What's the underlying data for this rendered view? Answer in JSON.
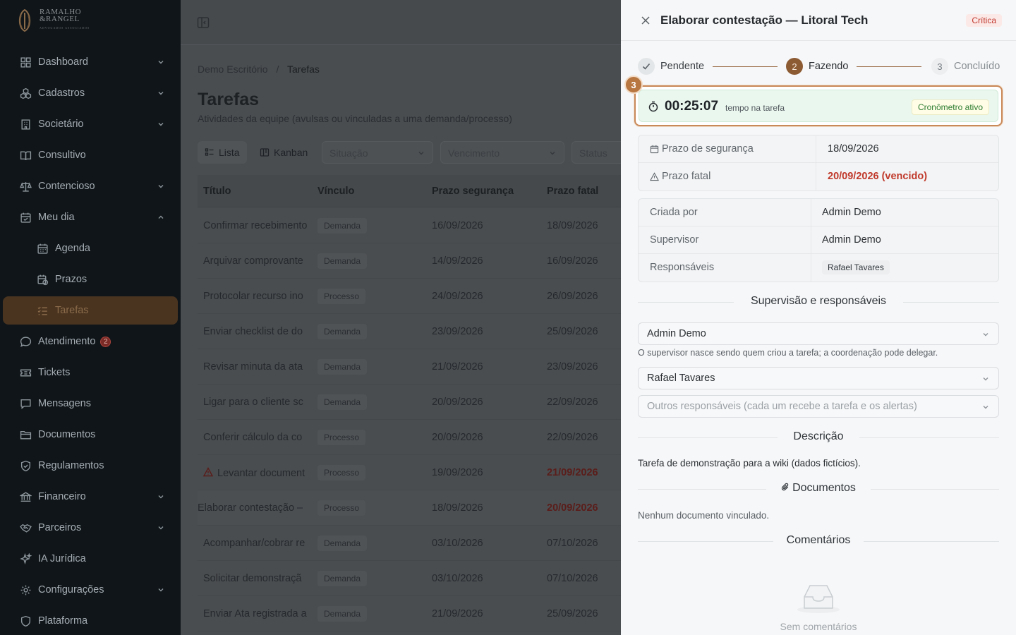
{
  "brand": {
    "name_line1": "RAMALHO",
    "name_line2": "&RANGEL",
    "name_line3": "ADVOGADOS ASSOCIADOS"
  },
  "sidebar": {
    "items": [
      {
        "label": "Dashboard",
        "icon": "dashboard-icon",
        "expandable": true
      },
      {
        "label": "Cadastros",
        "icon": "cubes-icon",
        "expandable": true
      },
      {
        "label": "Societário",
        "icon": "building-icon",
        "expandable": true
      },
      {
        "label": "Consultivo",
        "icon": "book-icon",
        "expandable": false
      },
      {
        "label": "Contencioso",
        "icon": "scale-icon",
        "expandable": true
      },
      {
        "label": "Meu dia",
        "icon": "calendar-icon",
        "expandable": true,
        "expanded": true
      },
      {
        "label": "Agenda",
        "icon": "calendar-grid-icon",
        "sub": true
      },
      {
        "label": "Prazos",
        "icon": "calendar-clock-icon",
        "sub": true
      },
      {
        "label": "Tarefas",
        "icon": "task-list-icon",
        "sub": true,
        "active": true
      },
      {
        "label": "Atendimento",
        "icon": "chat-icon",
        "badge": "2"
      },
      {
        "label": "Tickets",
        "icon": "ticket-icon"
      },
      {
        "label": "Mensagens",
        "icon": "message-icon"
      },
      {
        "label": "Documentos",
        "icon": "folder-icon"
      },
      {
        "label": "Regulamentos",
        "icon": "shield-icon"
      },
      {
        "label": "Financeiro",
        "icon": "bank-icon",
        "expandable": true
      },
      {
        "label": "Parceiros",
        "icon": "handshake-icon",
        "expandable": true
      },
      {
        "label": "IA Jurídica",
        "icon": "sparkles-icon"
      },
      {
        "label": "Configurações",
        "icon": "gear-icon",
        "expandable": true
      },
      {
        "label": "Plataforma",
        "icon": "shield-check-icon"
      }
    ]
  },
  "main": {
    "breadcrumb": {
      "root": "Demo Escritório",
      "sep": "/",
      "current": "Tarefas"
    },
    "title": "Tarefas",
    "subtitle": "Atividades da equipe (avulsas ou vinculadas a uma demanda/processo)",
    "views": {
      "list": "Lista",
      "kanban": "Kanban"
    },
    "filters": {
      "situacao": "Situação",
      "vencimento": "Vencimento",
      "status": "Status"
    },
    "columns": {
      "title": "Título",
      "link": "Vínculo",
      "safe": "Prazo segurança",
      "fatal": "Prazo fatal"
    },
    "rows": [
      {
        "title": "Confirmar recebimento",
        "link": "Demanda",
        "safe": "16/09/2026",
        "fatal": "18/09/2026"
      },
      {
        "title": "Arquivar comprovante",
        "link": "Demanda",
        "safe": "14/09/2026",
        "fatal": "16/09/2026"
      },
      {
        "title": "Protocolar recurso ino",
        "link": "Processo",
        "safe": "24/09/2026",
        "fatal": "26/09/2026"
      },
      {
        "title": "Enviar checklist de do",
        "link": "Demanda",
        "safe": "23/09/2026",
        "fatal": "25/09/2026"
      },
      {
        "title": "Revisar minuta da ata",
        "link": "Demanda",
        "safe": "21/09/2026",
        "fatal": "23/09/2026"
      },
      {
        "title": "Ligar para o cliente sc",
        "link": "Demanda",
        "safe": "20/09/2026",
        "fatal": "22/09/2026"
      },
      {
        "title": "Conferir cálculo da co",
        "link": "Processo",
        "safe": "20/09/2026",
        "fatal": "22/09/2026"
      },
      {
        "title": "Levantar document",
        "link": "Processo",
        "safe": "19/09/2026",
        "fatal": "21/09/2026"
      },
      {
        "title": "Elaborar contestação –",
        "link": "Processo",
        "safe": "18/09/2026",
        "fatal": "20/09/2026"
      },
      {
        "title": "Acompanhar/cobrar re",
        "link": "Demanda",
        "safe": "03/10/2026",
        "fatal": "07/10/2026"
      },
      {
        "title": "Solicitar demonstraçã",
        "link": "Demanda",
        "safe": "03/10/2026",
        "fatal": "07/10/2026"
      },
      {
        "title": "Enviar Ata registrada a",
        "link": "Demanda",
        "safe": "21/09/2026",
        "fatal": "25/09/2026"
      }
    ]
  },
  "drawer": {
    "title": "Elaborar contestação — Litoral Tech",
    "priority": "Crítica",
    "steps": [
      {
        "num": "✓",
        "label": "Pendente"
      },
      {
        "num": "2",
        "label": "Fazendo"
      },
      {
        "num": "3",
        "label": "Concluído"
      }
    ],
    "step_badge": "3",
    "timer": {
      "value": "00:25:07",
      "label": "tempo na tarefa",
      "state": "Cronômetro ativo"
    },
    "deadlines": {
      "safe_label": "Prazo de segurança",
      "safe_value": "18/09/2026",
      "fatal_label": "Prazo fatal",
      "fatal_value": "20/09/2026 (vencido)"
    },
    "people": {
      "created_label": "Criada por",
      "created_value": "Admin Demo",
      "supervisor_label": "Supervisor",
      "supervisor_value": "Admin Demo",
      "resp_label": "Responsáveis",
      "resp_value": "Rafael Tavares"
    },
    "supervision": {
      "heading": "Supervisão e responsáveis",
      "supervisor_select": "Admin Demo",
      "hint": "O supervisor nasce sendo quem criou a tarefa; a coordenação pode delegar.",
      "responsible_select": "Rafael Tavares",
      "others_placeholder": "Outros responsáveis (cada um recebe a tarefa e os alertas)"
    },
    "description": {
      "heading": "Descrição",
      "text": "Tarefa de demonstração para a wiki (dados fictícios)."
    },
    "documents": {
      "heading": "Documentos",
      "empty": "Nenhum documento vinculado."
    },
    "comments": {
      "heading": "Comentários",
      "empty": "Sem comentários"
    }
  }
}
